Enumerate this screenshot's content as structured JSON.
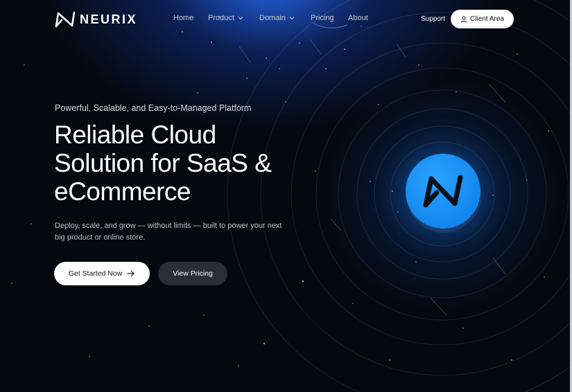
{
  "brand": {
    "name": "NEURIX",
    "logo_icon": "neurix-logo-icon",
    "accent_color": "#1a8cf0",
    "background_color": "#05080f"
  },
  "nav": {
    "items": [
      {
        "label": "Home",
        "has_dropdown": false
      },
      {
        "label": "Product",
        "has_dropdown": true
      },
      {
        "label": "Domain",
        "has_dropdown": true
      },
      {
        "label": "Pricing",
        "has_dropdown": false
      },
      {
        "label": "About",
        "has_dropdown": false
      }
    ],
    "support_label": "Support",
    "client_area_label": "Client Area",
    "client_area_icon": "user-icon"
  },
  "hero": {
    "tagline": "Powerful, Scalable, and Easy-to-Managed Platform",
    "headline_lines": [
      "Reliable Cloud",
      "Solution for SaaS &",
      "eCommerce"
    ],
    "description": "Deploy, scale, and grow — without limits — built to power your next big product or online store.",
    "primary_cta": "Get Started Now",
    "primary_cta_icon": "arrow-right-icon",
    "secondary_cta": "View Pricing"
  }
}
